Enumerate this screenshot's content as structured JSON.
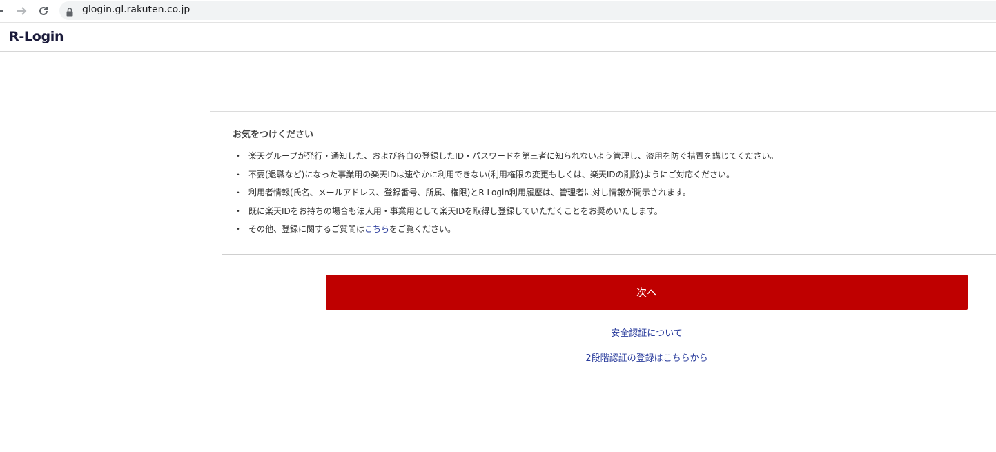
{
  "browser": {
    "url": "glogin.gl.rakuten.co.jp"
  },
  "header": {
    "logo": "R-Login"
  },
  "notice": {
    "title": "お気をつけください",
    "bullet": "・",
    "items": [
      {
        "text": "楽天グループが発行・通知した、および各自の登録したID・パスワードを第三者に知られないよう管理し、盗用を防ぐ措置を講じてください。"
      },
      {
        "text": "不要(退職など)になった事業用の楽天IDは速やかに利用できない(利用権限の変更もしくは、楽天IDの削除)ようにご対応ください。"
      },
      {
        "text": "利用者情報(氏名、メールアドレス、登録番号、所属、権限)とR-Login利用履歴は、管理者に対し情報が開示されます。"
      },
      {
        "text": "既に楽天IDをお持ちの場合も法人用・事業用として楽天IDを取得し登録していただくことをお奨めいたします。"
      },
      {
        "text_before": "その他、登録に関するご質問は",
        "link": "こちら",
        "text_after": "をご覧ください。"
      }
    ]
  },
  "actions": {
    "next_label": "次へ",
    "security_link": "安全認証について",
    "two_factor_link": "2段階認証の登録はこちらから"
  },
  "colors": {
    "primary": "#bf0000",
    "link": "#2a3c9c"
  }
}
